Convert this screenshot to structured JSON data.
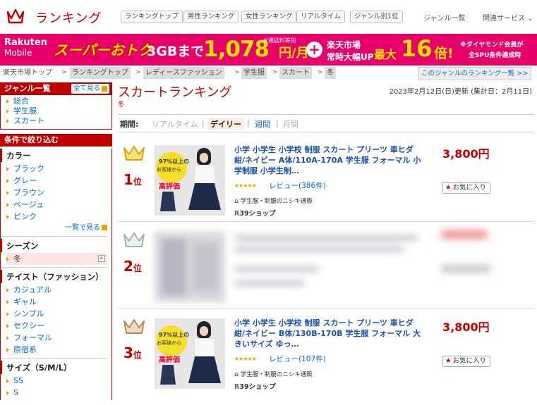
{
  "header": {
    "logo_text": "ランキング",
    "nav": [
      "ランキングトップ",
      "男性ランキング",
      "女性ランキング",
      "リアルタイム",
      "ジャンル別1位"
    ],
    "genre_list": "ジャンル一覧",
    "related": "関連サービス"
  },
  "banner": {
    "brand_line1": "Rakuten",
    "brand_line2": "Mobile",
    "super": "スーパーおトク",
    "gb": "3GBまで",
    "note": "※通話料等別",
    "price": "1,078",
    "unit": "円/月",
    "plus": "+",
    "rk_line1": "楽天市場",
    "rk_line2": "常時大幅UP",
    "max": "最大",
    "times": "16",
    "bai": "倍!",
    "dia_line1": "※ダイヤモンド会員が",
    "dia_line2": "全SPU条件達成時"
  },
  "breadcrumb": {
    "items": [
      "楽天市場トップ",
      "ランキングトップ",
      "レディースファッション",
      "学生服",
      "スカート",
      "冬"
    ],
    "separator": ">",
    "genre_more": "このジャンルのランキング一覧 >>"
  },
  "sidebar": {
    "genre_title": "ジャンル一覧",
    "see_all": "全て見る",
    "genres": [
      "総合",
      "学生服",
      "スカート"
    ],
    "filter_title": "条件で絞り込む",
    "color": {
      "title": "カラー",
      "items": [
        "ブラック",
        "グレー",
        "ブラウン",
        "ベージュ",
        "ピンク"
      ],
      "more": "一覧で見る"
    },
    "season": {
      "title": "シーズン",
      "selected": "冬"
    },
    "taste": {
      "title": "テイスト（ファッション）",
      "items": [
        "カジュアル",
        "ギャル",
        "シンプル",
        "セクシー",
        "フォーマル",
        "原宿系"
      ]
    },
    "size": {
      "title": "サイズ（S/M/L）",
      "items": [
        "SS",
        "S"
      ]
    }
  },
  "main": {
    "title": "スカートランキング",
    "subtitle": "冬",
    "date": "2023年2月12日(日)更新 (集計日：2月11日)",
    "period_label": "期間:",
    "periods": [
      "リアルタイム",
      "デイリー",
      "週間",
      "月間"
    ]
  },
  "items": [
    {
      "rank": "1",
      "rank_suffix": "位",
      "title": "小学 小学生 小学校 制服 スカート プリーツ 車ヒダ 紺/ネイビー A体/110A-170A 学生服 フォーマル 小学制服 小学生制…",
      "price": "3,800円",
      "stars": "★★★★★",
      "review": "レビュー(386件)",
      "shop_sub": "学生服・制服のニシキ通販",
      "shop": "39ショップ",
      "fav": "お気に入り",
      "thumb_pct": "97%以上の",
      "thumb_t1": "お客様から",
      "thumb_t2": "高評価"
    },
    {
      "rank": "2",
      "rank_suffix": "位"
    },
    {
      "rank": "3",
      "rank_suffix": "位",
      "title": "小学 小学生 小学校 制服 スカート プリーツ 車ヒダ 紺/ネイビー B体/130B-170B 学生服 フォーマル 大きいサイズ ゆっ…",
      "price": "3,800円",
      "stars": "★★★★★",
      "review": "レビュー(107件)",
      "shop_sub": "学生服・制服のニシキ通販",
      "shop": "39ショップ",
      "fav": "お気に入り",
      "thumb_pct": "97%以上の",
      "thumb_t1": "お客様から",
      "thumb_t2": "高評価"
    }
  ],
  "colors": {
    "brand_red": "#bf0000",
    "banner_pink": "#e8006a",
    "link_blue": "#0066cc",
    "gold": "#e8a000"
  }
}
